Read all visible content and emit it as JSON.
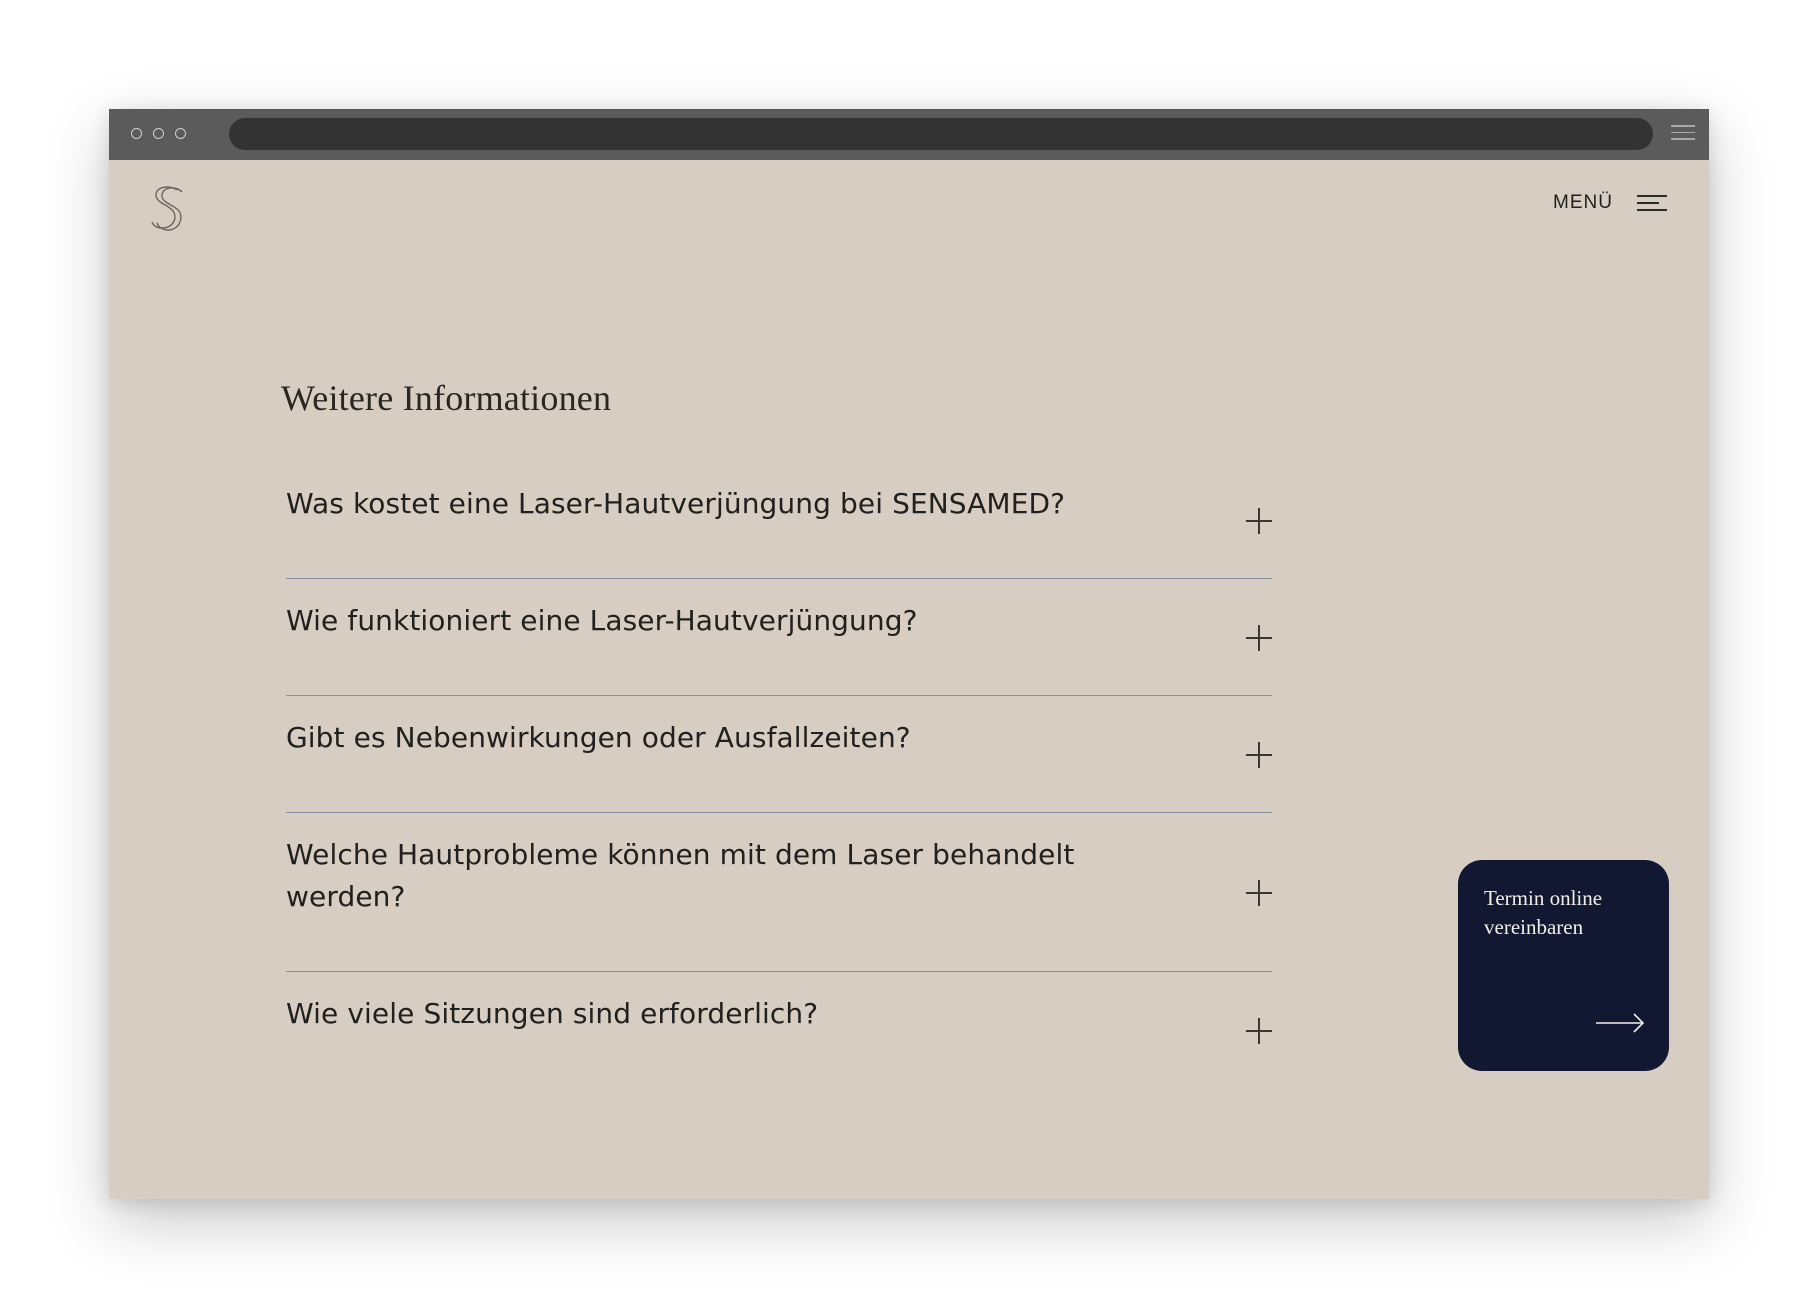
{
  "header": {
    "menu_label": "MENÜ"
  },
  "section": {
    "title": "Weitere Informationen"
  },
  "faq": {
    "items": [
      {
        "question": "Was kostet eine Laser-Hautverjüngung bei SENSAMED?"
      },
      {
        "question": "Wie funktioniert eine Laser-Hautverjüngung?"
      },
      {
        "question": "Gibt es Nebenwirkungen oder Ausfallzeiten?"
      },
      {
        "question": "Welche Hautprobleme können mit dem Laser behandelt werden?"
      },
      {
        "question": "Wie viele Sitzungen sind erforderlich?"
      }
    ]
  },
  "cta": {
    "label": "Termin online vereinbaren"
  },
  "icons": {
    "logo": "sensamed-s-logo",
    "menu": "hamburger-icon",
    "expand": "plus-icon",
    "cta": "arrow-right-icon"
  },
  "colors": {
    "background": "#d7cdc3",
    "cta_background": "#121832",
    "divider": "#8a8fa3",
    "text": "#22201e"
  }
}
